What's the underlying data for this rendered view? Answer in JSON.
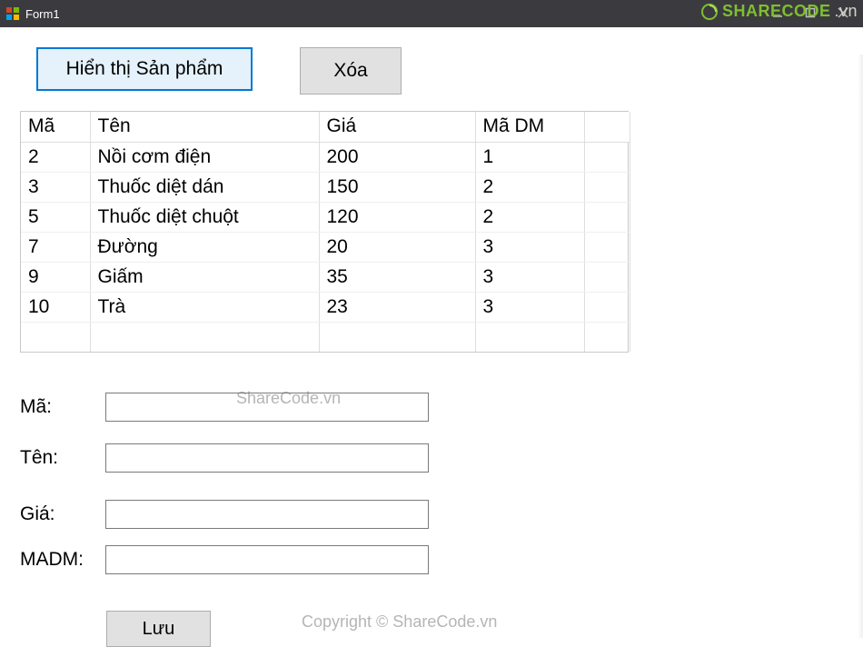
{
  "window": {
    "title": "Form1"
  },
  "logo": {
    "brand": "SHARECODE",
    "tld": ".vn"
  },
  "buttons": {
    "show_products": "Hiển thị Sản phẩm",
    "delete": "Xóa",
    "save": "Lưu"
  },
  "grid": {
    "headers": {
      "ma": "Mã",
      "ten": "Tên",
      "gia": "Giá",
      "madm": "Mã DM"
    },
    "rows": [
      {
        "ma": "2",
        "ten": "Nồi cơm điện",
        "gia": "200",
        "madm": "1"
      },
      {
        "ma": "3",
        "ten": "Thuốc diệt dán",
        "gia": "150",
        "madm": "2"
      },
      {
        "ma": "5",
        "ten": "Thuốc diệt chuột",
        "gia": "120",
        "madm": "2"
      },
      {
        "ma": "7",
        "ten": "Đường",
        "gia": "20",
        "madm": "3"
      },
      {
        "ma": "9",
        "ten": "Giấm",
        "gia": "35",
        "madm": "3"
      },
      {
        "ma": "10",
        "ten": "Trà",
        "gia": "23",
        "madm": "3"
      }
    ]
  },
  "form": {
    "labels": {
      "ma": "Mã:",
      "ten": "Tên:",
      "gia": "Giá:",
      "madm": "MADM:"
    },
    "values": {
      "ma": "",
      "ten": "",
      "gia": "",
      "madm": ""
    }
  },
  "watermarks": {
    "center": "ShareCode.vn",
    "footer": "Copyright © ShareCode.vn"
  }
}
